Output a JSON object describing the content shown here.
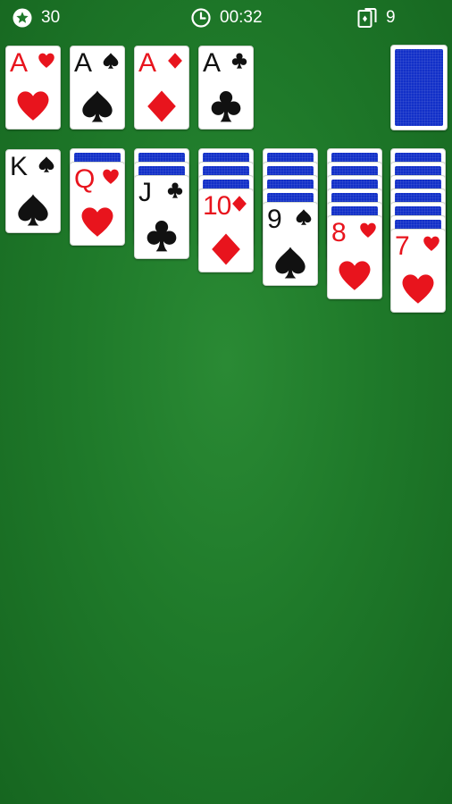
{
  "hud": {
    "score": "30",
    "timer": "00:32",
    "moves": "9",
    "icons": [
      "star-icon",
      "clock-icon",
      "cards-icon"
    ]
  },
  "colors": {
    "felt": "#1f7a2a",
    "red": "#e8141d",
    "black": "#111111",
    "card_back": "#1230c8"
  },
  "foundations": [
    {
      "rank": "A",
      "suit": "hearts"
    },
    {
      "rank": "A",
      "suit": "spades"
    },
    {
      "rank": "A",
      "suit": "diamonds"
    },
    {
      "rank": "A",
      "suit": "clubs"
    }
  ],
  "stock": {
    "face_down": true
  },
  "tableau": [
    {
      "hidden": 0,
      "top": {
        "rank": "K",
        "suit": "spades"
      }
    },
    {
      "hidden": 1,
      "top": {
        "rank": "Q",
        "suit": "hearts"
      }
    },
    {
      "hidden": 2,
      "top": {
        "rank": "J",
        "suit": "clubs"
      }
    },
    {
      "hidden": 3,
      "top": {
        "rank": "10",
        "suit": "diamonds"
      }
    },
    {
      "hidden": 4,
      "top": {
        "rank": "9",
        "suit": "spades"
      }
    },
    {
      "hidden": 5,
      "top": {
        "rank": "8",
        "suit": "hearts"
      }
    },
    {
      "hidden": 6,
      "top": {
        "rank": "7",
        "suit": "hearts"
      }
    }
  ]
}
